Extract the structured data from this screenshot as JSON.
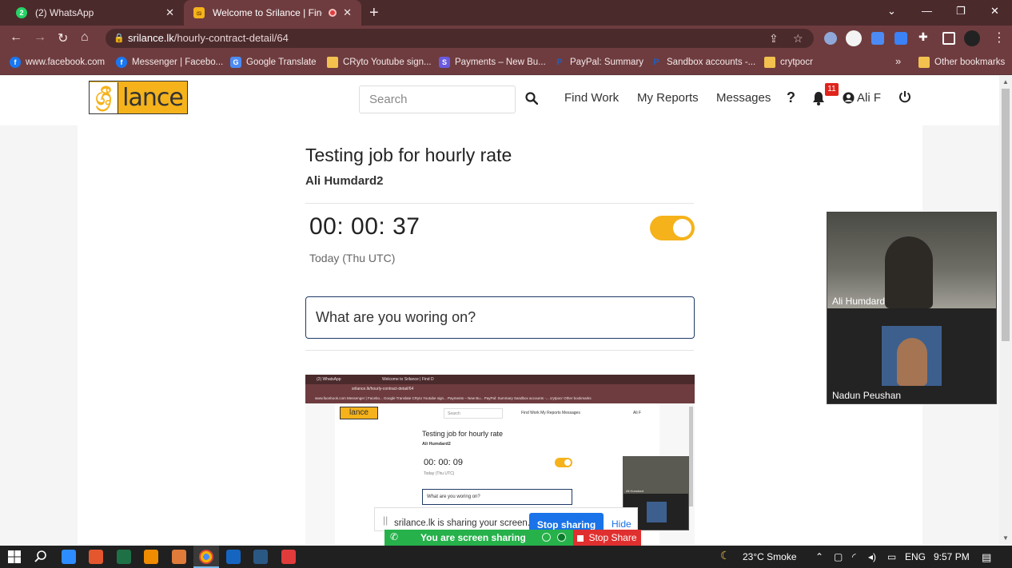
{
  "browser": {
    "tabs": [
      {
        "title": "(2) WhatsApp",
        "favicon": "whatsapp-icon",
        "close": "✕"
      },
      {
        "title": "Welcome to Srilance | Find D",
        "favicon": "srilance-icon",
        "close": "✕"
      }
    ],
    "url_host": "srilance.lk",
    "url_path": "/hourly-contract-detail/64",
    "bookmarks": [
      "www.facebook.com",
      "Messenger | Facebo...",
      "Google Translate",
      "CRyto Youtube sign...",
      "Payments – New Bu...",
      "PayPal: Summary",
      "Sandbox accounts -...",
      "crytpocr",
      "Other bookmarks"
    ],
    "bookmarks_overflow": "»",
    "window_controls": {
      "minimize": "—",
      "restore": "❐",
      "close": "✕",
      "tab_search": "⌄"
    }
  },
  "site": {
    "logo_mark": "ශ්‍රී",
    "logo_text": "lance",
    "search_placeholder": "Search",
    "nav": {
      "find_work": "Find Work",
      "my_reports": "My Reports",
      "messages": "Messages",
      "help": "?"
    },
    "notifications_count": "11",
    "user_name": "Ali F"
  },
  "job": {
    "title": "Testing job for hourly rate",
    "client": "Ali Humdard2",
    "timer": "00: 00: 37",
    "timer_note": "Today (Thu UTC)",
    "tracking_on": true,
    "work_placeholder": "What are you woring on?"
  },
  "mirror": {
    "tab1": "(2) WhatsApp",
    "tab2": "Welcome to Srilance | Find D",
    "url": "srilance.lk/hourly-contract-detail/64",
    "bookmarks": "www.facebook.com   Messenger | Facebo...   Google Translate   CRyto Youtube sign...   Payments – New Bu...   PayPal: Summary   Sandbox accounts -...   crytpocr      Other bookmarks",
    "logo_text": "lance",
    "search": "Search",
    "nav": "Find Work     My Reports     Messages",
    "user": "Ali F",
    "title": "Testing job for hourly rate",
    "client": "Ali Humdard2",
    "timer": "00: 00: 09",
    "timer_note": "Today (Thu UTC)",
    "input": "What are you woring on?",
    "video_name": "Ali Humdard",
    "share_msg": "srilance.lk is sharing your screen.",
    "stop_sharing": "Stop sharing",
    "hide": "Hide"
  },
  "zoom": {
    "participant1": "Ali Humdard",
    "participant2": "Nadun Peushan"
  },
  "share": {
    "message": "srilance.lk is sharing your screen.",
    "stop_sharing": "Stop sharing",
    "hide": "Hide",
    "zoom_status": "You are screen sharing",
    "stop_share": "Stop Share"
  },
  "taskbar": {
    "weather": "23°C  Smoke",
    "lang": "ENG",
    "time": "9:57 PM"
  },
  "colors": {
    "accent": "#f5b21b",
    "browser_frame": "#6e3c3f",
    "zoom_green": "#26b14b",
    "stop_red": "#e02f2f",
    "share_blue": "#1a73e8"
  }
}
